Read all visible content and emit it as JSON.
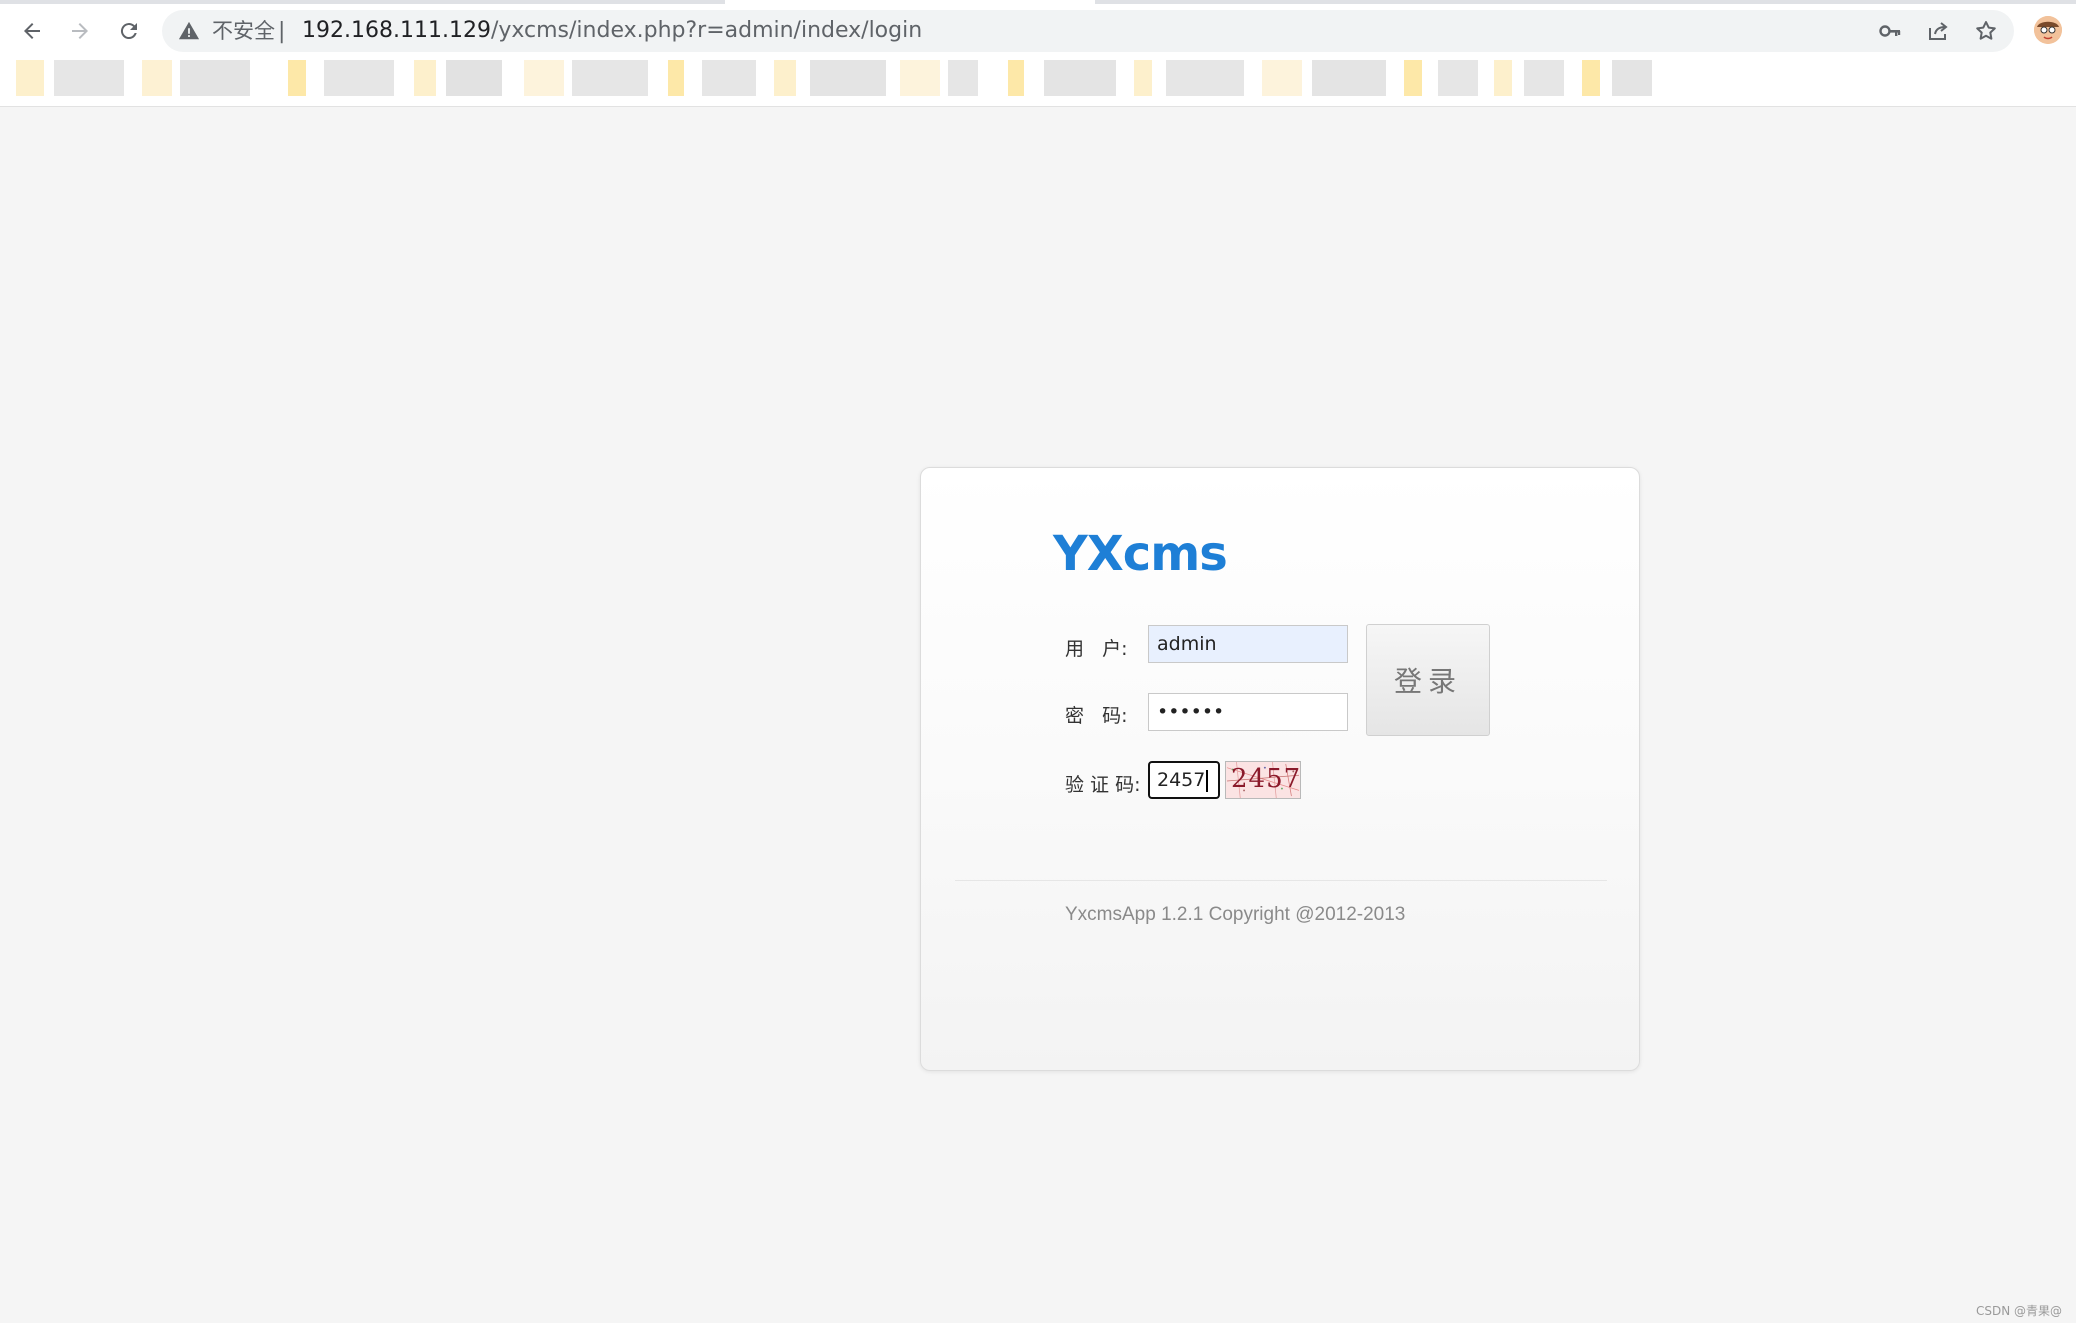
{
  "browser": {
    "security_label": "不安全",
    "separator": "|",
    "url_host": "192.168.111.129",
    "url_path": "/yxcms/index.php?r=admin/index/login",
    "icons": [
      "back-icon",
      "forward-icon",
      "reload-icon",
      "warning-icon",
      "key-icon",
      "share-icon",
      "star-icon",
      "profile-avatar"
    ]
  },
  "login": {
    "logo": "YXcms",
    "username_label": "用   户:",
    "username_value": "admin",
    "password_label": "密   码:",
    "password_value": "••••••",
    "captcha_label": "验 证 码:",
    "captcha_value": "2457",
    "captcha_image_text": "2457",
    "submit_label": "登录",
    "copyright": "YxcmsApp 1.2.1 Copyright @2012-2013"
  },
  "watermark": "CSDN @青果@",
  "colors": {
    "logo": "#1e7fd6",
    "page_bg": "#f5f5f5",
    "autofill_bg": "#e8f0fe",
    "captcha_bg": "#fbe3e3",
    "captcha_digits": "#8b1a2b"
  }
}
